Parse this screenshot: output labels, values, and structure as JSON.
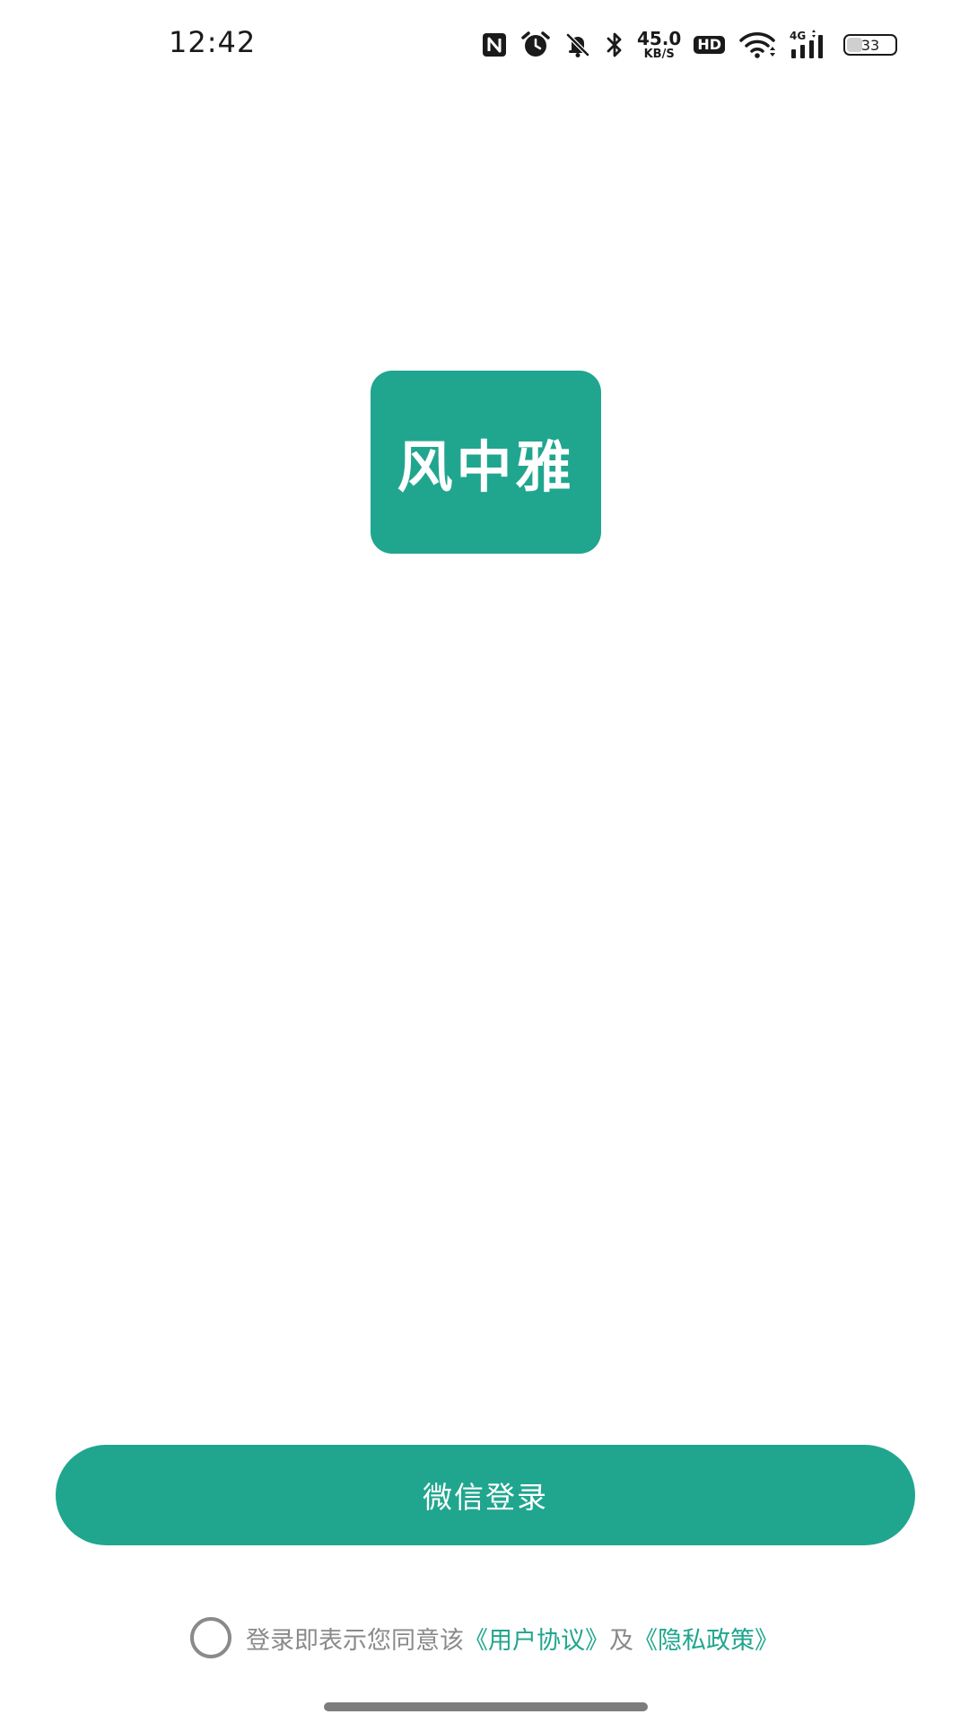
{
  "status_bar": {
    "time": "12:42",
    "net_speed_value": "45.0",
    "net_speed_unit": "KB/S",
    "hd_label": "HD",
    "network_type": "4G",
    "battery_level": "33",
    "battery_fraction": 0.33
  },
  "logo": {
    "text": "风中雅",
    "color": "#20a68e"
  },
  "login": {
    "button_label": "微信登录"
  },
  "agreement": {
    "prefix": "登录即表示您同意该",
    "user_agreement": "《用户协议》",
    "conjunction": "及",
    "privacy_policy": "《隐私政策》"
  },
  "colors": {
    "accent": "#20a68e",
    "muted_text": "#8a8a8a"
  }
}
